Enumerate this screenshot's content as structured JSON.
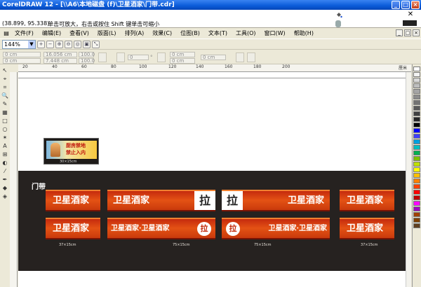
{
  "window": {
    "title": "CorelDRAW 12 - [\\\\A6\\本地磁盘 (f)\\卫星酒家\\门带.cdr]",
    "controls": [
      "_",
      "□",
      "×"
    ]
  },
  "hint_bar": {
    "coords": "(38.899, 95.338)",
    "hint": "单击可放大，右击或按住 Shift 键单击可缩小"
  },
  "menu": {
    "items": [
      "文件(F)",
      "编辑(E)",
      "查看(V)",
      "版面(L)",
      "排列(A)",
      "效果(C)",
      "位图(B)",
      "文本(T)",
      "工具(O)",
      "窗口(W)",
      "帮助(H)"
    ],
    "doc_controls": [
      "_",
      "□",
      "×"
    ]
  },
  "toolbar": {
    "zoom_value": "144%",
    "zoom_buttons": [
      "+",
      "−",
      "⊕",
      "⊖",
      "◎",
      "▣",
      "⤡"
    ]
  },
  "property_bar": {
    "x": "0 cm",
    "y": "0 cm",
    "width": "16.056 cm",
    "height": "7.448 cm",
    "scale_w": "100.0",
    "scale_h": "100.0",
    "angle": "0",
    "angle_unit": "°",
    "pos_x": "0 cm",
    "pos_y": "0 cm",
    "outline": "0 cm"
  },
  "ruler": {
    "h_ticks": [
      "20",
      "40",
      "60",
      "80",
      "100",
      "120",
      "140",
      "160",
      "180",
      "200"
    ],
    "unit": "厘米"
  },
  "toolbox": {
    "icons": [
      "pick-tool-icon",
      "shape-tool-icon",
      "crop-tool-icon",
      "zoom-tool-icon",
      "freehand-tool-icon",
      "smart-fill-icon",
      "rectangle-tool-icon",
      "ellipse-tool-icon",
      "polygon-tool-icon",
      "text-tool-icon",
      "table-tool-icon",
      "interactive-tool-icon",
      "eyedropper-icon",
      "outline-tool-icon",
      "fill-tool-icon",
      "interactive-fill-icon"
    ],
    "glyphs": [
      "↖",
      "⌖",
      "⌗",
      "🔍",
      "✎",
      "▦",
      "□",
      "○",
      "✶",
      "A",
      "⊞",
      "◐",
      "⁄",
      "✒",
      "◆",
      "◈"
    ]
  },
  "palette": {
    "swatches": [
      "#ffffff",
      "#f2f2f2",
      "#d9d9d9",
      "#bfbfbf",
      "#a6a6a6",
      "#8c8c8c",
      "#737373",
      "#595959",
      "#404040",
      "#262626",
      "#000000",
      "#0000ff",
      "#4040ff",
      "#00a0e0",
      "#00c0c0",
      "#00b050",
      "#7fc000",
      "#c0e000",
      "#ffff00",
      "#ffc000",
      "#ff8000",
      "#ff4000",
      "#ff0000",
      "#c00000",
      "#ff00ff",
      "#a000c0",
      "#a04000",
      "#804000",
      "#604020"
    ]
  },
  "document": {
    "band_title": "门带",
    "brand_name": "卫星酒家",
    "brand_combo": "卫星酒家·卫星酒家",
    "pull_char": "拉",
    "dims": {
      "short": "37×15cm",
      "long": "75×15cm"
    },
    "notice": {
      "line1": "厨房禁地",
      "line2": "禁止入内",
      "dim": "30×15cm"
    }
  }
}
